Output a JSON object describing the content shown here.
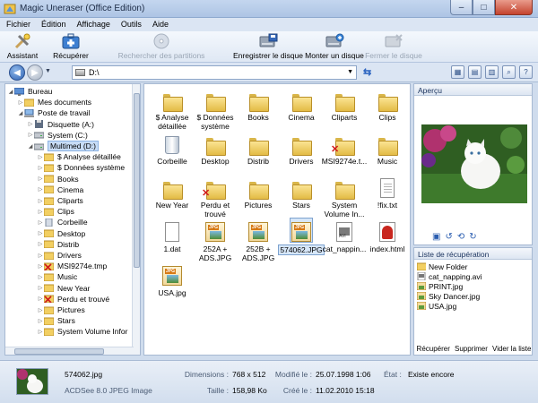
{
  "window": {
    "title": "Magic Uneraser (Office Edition)",
    "minimize": "–",
    "maximize": "□",
    "close": "✕"
  },
  "menu": [
    "Fichier",
    "Édition",
    "Affichage",
    "Outils",
    "Aide"
  ],
  "toolbar": {
    "assistant": "Assistant",
    "recover": "Récupérer",
    "search_partitions": "Rechercher des partitions",
    "save_disk": "Enregistrer le disque",
    "mount_disk": "Monter un disque",
    "close_disk": "Fermer le disque"
  },
  "address": {
    "path": "D:\\"
  },
  "tree": [
    {
      "label": "Bureau",
      "icon": "desktop-icon",
      "depth": 0,
      "expanded": true
    },
    {
      "label": "Mes documents",
      "icon": "folder-icon",
      "depth": 1,
      "expanded": false
    },
    {
      "label": "Poste de travail",
      "icon": "computer-icon",
      "depth": 1,
      "expanded": true
    },
    {
      "label": "Disquette (A:)",
      "icon": "floppy-icon",
      "depth": 2,
      "expanded": false
    },
    {
      "label": "System (C:)",
      "icon": "drive-icon",
      "depth": 2,
      "expanded": false
    },
    {
      "label": "Multimed (D:)",
      "icon": "drive-icon",
      "depth": 2,
      "expanded": true,
      "selected": true
    },
    {
      "label": "$ Analyse détaillée",
      "icon": "folder-icon",
      "depth": 3
    },
    {
      "label": "$ Données système",
      "icon": "folder-icon",
      "depth": 3
    },
    {
      "label": "Books",
      "icon": "folder-icon",
      "depth": 3
    },
    {
      "label": "Cinema",
      "icon": "folder-icon",
      "depth": 3
    },
    {
      "label": "Cliparts",
      "icon": "folder-icon",
      "depth": 3
    },
    {
      "label": "Clips",
      "icon": "folder-icon",
      "depth": 3
    },
    {
      "label": "Corbeille",
      "icon": "recycle-bin-icon",
      "depth": 3
    },
    {
      "label": "Desktop",
      "icon": "folder-icon",
      "depth": 3
    },
    {
      "label": "Distrib",
      "icon": "folder-icon",
      "depth": 3
    },
    {
      "label": "Drivers",
      "icon": "folder-icon",
      "depth": 3
    },
    {
      "label": "MSI9274e.tmp",
      "icon": "deleted-folder-icon",
      "depth": 3
    },
    {
      "label": "Music",
      "icon": "folder-icon",
      "depth": 3
    },
    {
      "label": "New Year",
      "icon": "folder-icon",
      "depth": 3
    },
    {
      "label": "Perdu et trouvé",
      "icon": "deleted-folder-icon",
      "depth": 3
    },
    {
      "label": "Pictures",
      "icon": "folder-icon",
      "depth": 3
    },
    {
      "label": "Stars",
      "icon": "folder-icon",
      "depth": 3
    },
    {
      "label": "System Volume Infor",
      "icon": "folder-icon",
      "depth": 3
    }
  ],
  "files": [
    {
      "name": "$ Analyse détaillée",
      "type": "folder"
    },
    {
      "name": "$ Données système",
      "type": "folder"
    },
    {
      "name": "Books",
      "type": "folder"
    },
    {
      "name": "Cinema",
      "type": "folder"
    },
    {
      "name": "Cliparts",
      "type": "folder"
    },
    {
      "name": "Clips",
      "type": "folder"
    },
    {
      "name": "Corbeille",
      "type": "recycle-bin"
    },
    {
      "name": "Desktop",
      "type": "folder"
    },
    {
      "name": "Distrib",
      "type": "folder"
    },
    {
      "name": "Drivers",
      "type": "folder"
    },
    {
      "name": "MSI9274e.t...",
      "type": "folder-deleted"
    },
    {
      "name": "Music",
      "type": "folder"
    },
    {
      "name": "New Year",
      "type": "folder"
    },
    {
      "name": "Perdu et trouvé",
      "type": "folder-deleted"
    },
    {
      "name": "Pictures",
      "type": "folder"
    },
    {
      "name": "Stars",
      "type": "folder"
    },
    {
      "name": "System Volume In...",
      "type": "folder"
    },
    {
      "name": "!fix.txt",
      "type": "text"
    },
    {
      "name": "1.dat",
      "type": "doc"
    },
    {
      "name": "252A + ADS.JPG",
      "type": "jpg"
    },
    {
      "name": "252B + ADS.JPG",
      "type": "jpg"
    },
    {
      "name": "574062.JPG",
      "type": "jpg",
      "selected": true
    },
    {
      "name": "cat_nappin...",
      "type": "avi"
    },
    {
      "name": "index.html",
      "type": "html"
    },
    {
      "name": "USA.jpg",
      "type": "jpg"
    }
  ],
  "preview": {
    "title": "Aperçu"
  },
  "recovery": {
    "title": "Liste de récupération",
    "items": [
      {
        "label": "New Folder",
        "icon": "folder-icon"
      },
      {
        "label": "cat_napping.avi",
        "icon": "video-file-icon"
      },
      {
        "label": "PRINT.jpg",
        "icon": "image-file-icon"
      },
      {
        "label": "Sky Dancer.jpg",
        "icon": "image-file-icon"
      },
      {
        "label": "USA.jpg",
        "icon": "image-file-icon"
      }
    ],
    "buttons": {
      "recover": "Récupérer",
      "delete": "Supprimer",
      "clear": "Vider la liste"
    }
  },
  "status": {
    "filename": "574062.jpg",
    "filetype": "ACDSee 8.0 JPEG Image",
    "dimensions_label": "Dimensions :",
    "dimensions_value": "768 x 512",
    "size_label": "Taille :",
    "size_value": "158,98 Ko",
    "modified_label": "Modifié le :",
    "modified_value": "25.07.1998 1:06",
    "created_label": "Créé le :",
    "created_value": "11.02.2010 15:18",
    "state_label": "État :",
    "state_value": "Existe encore"
  },
  "colors": {
    "accent": "#2f63b3",
    "selection": "#c7dcf6",
    "deleted_mark": "#d01a1a"
  }
}
